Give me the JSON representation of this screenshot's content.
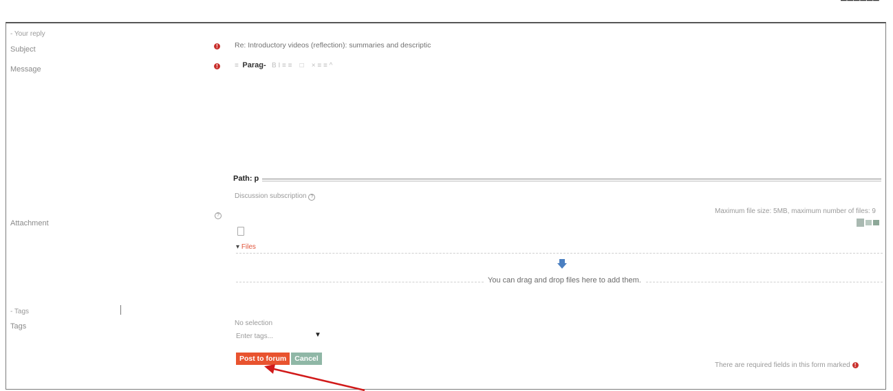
{
  "form": {
    "section_reply": "- Your reply",
    "subject_label": "Subject",
    "subject_value": "Re: Introductory videos (reflection): summaries and descriptic",
    "message_label": "Message",
    "toolbar": {
      "menu_glyph": "≡",
      "paragraph_label": "Parag-",
      "format_glyphs": "B  I  ≡  ≡",
      "extra_glyphs": "□",
      "more_glyphs": "×  ≡  ≡  ^"
    },
    "path_label": "Path: p",
    "discussion_subscription": "Discussion subscription",
    "attachment_label": "Attachment",
    "max_file_info": "Maximum file size: 5MB, maximum number of files: 9",
    "files_label": "Files",
    "dropzone_text": "You can drag and drop files here to add them.",
    "section_tags": "- Tags",
    "tags_label": "Tags",
    "no_selection": "No selection",
    "tags_placeholder": "Enter tags...",
    "post_button": "Post to forum",
    "cancel_button": "Cancel",
    "required_note": "There are required fields in this form marked",
    "required_glyph": "!",
    "help_glyph": "?"
  },
  "colors": {
    "post_button": "#e8532f",
    "cancel_button": "#8fb7a6",
    "required_icon": "#c9302c",
    "annotation_arrow": "#d11a1a",
    "upload_arrow": "#4a7fc1"
  }
}
